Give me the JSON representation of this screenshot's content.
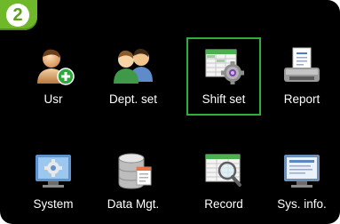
{
  "badge": {
    "number": "2"
  },
  "menu": [
    {
      "label": "Usr",
      "icon": "user-add-icon"
    },
    {
      "label": "Dept. set",
      "icon": "department-icon"
    },
    {
      "label": "Shift set",
      "icon": "shift-settings-icon",
      "selected": true
    },
    {
      "label": "Report",
      "icon": "report-printer-icon"
    },
    {
      "label": "System",
      "icon": "system-monitor-icon"
    },
    {
      "label": "Data Mgt.",
      "icon": "database-icon"
    },
    {
      "label": "Record",
      "icon": "record-search-icon"
    },
    {
      "label": "Sys. info.",
      "icon": "system-info-icon"
    }
  ],
  "colors": {
    "background": "#000000",
    "selection": "#2fae3c",
    "badge": "#6fb82a"
  }
}
